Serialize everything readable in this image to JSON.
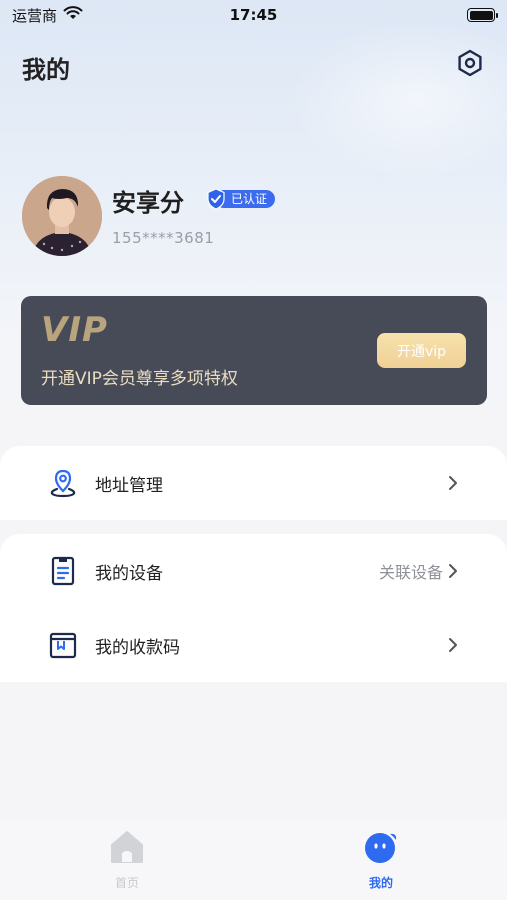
{
  "status_bar": {
    "carrier": "运营商",
    "time": "17:45"
  },
  "header": {
    "title": "我的",
    "settings_icon": "settings-hexagon-icon"
  },
  "profile": {
    "name": "安享分",
    "verified_label": "已认证",
    "phone": "155****3681"
  },
  "vip": {
    "logo_text": "VIP",
    "description": "开通VIP会员尊享多项特权",
    "button_label": "开通vip"
  },
  "menu": {
    "address": {
      "label": "地址管理",
      "icon": "location-pin-icon"
    },
    "devices": {
      "label": "我的设备",
      "sub": "关联设备",
      "icon": "clipboard-icon"
    },
    "payment_code": {
      "label": "我的收款码",
      "icon": "wallet-icon"
    }
  },
  "tabbar": {
    "home": {
      "label": "首页",
      "icon": "home-icon"
    },
    "mine": {
      "label": "我的",
      "icon": "mine-face-icon"
    }
  },
  "colors": {
    "accent": "#2f6bf0",
    "vip_card": "#474a57",
    "vip_gold": "#b8a47d"
  }
}
